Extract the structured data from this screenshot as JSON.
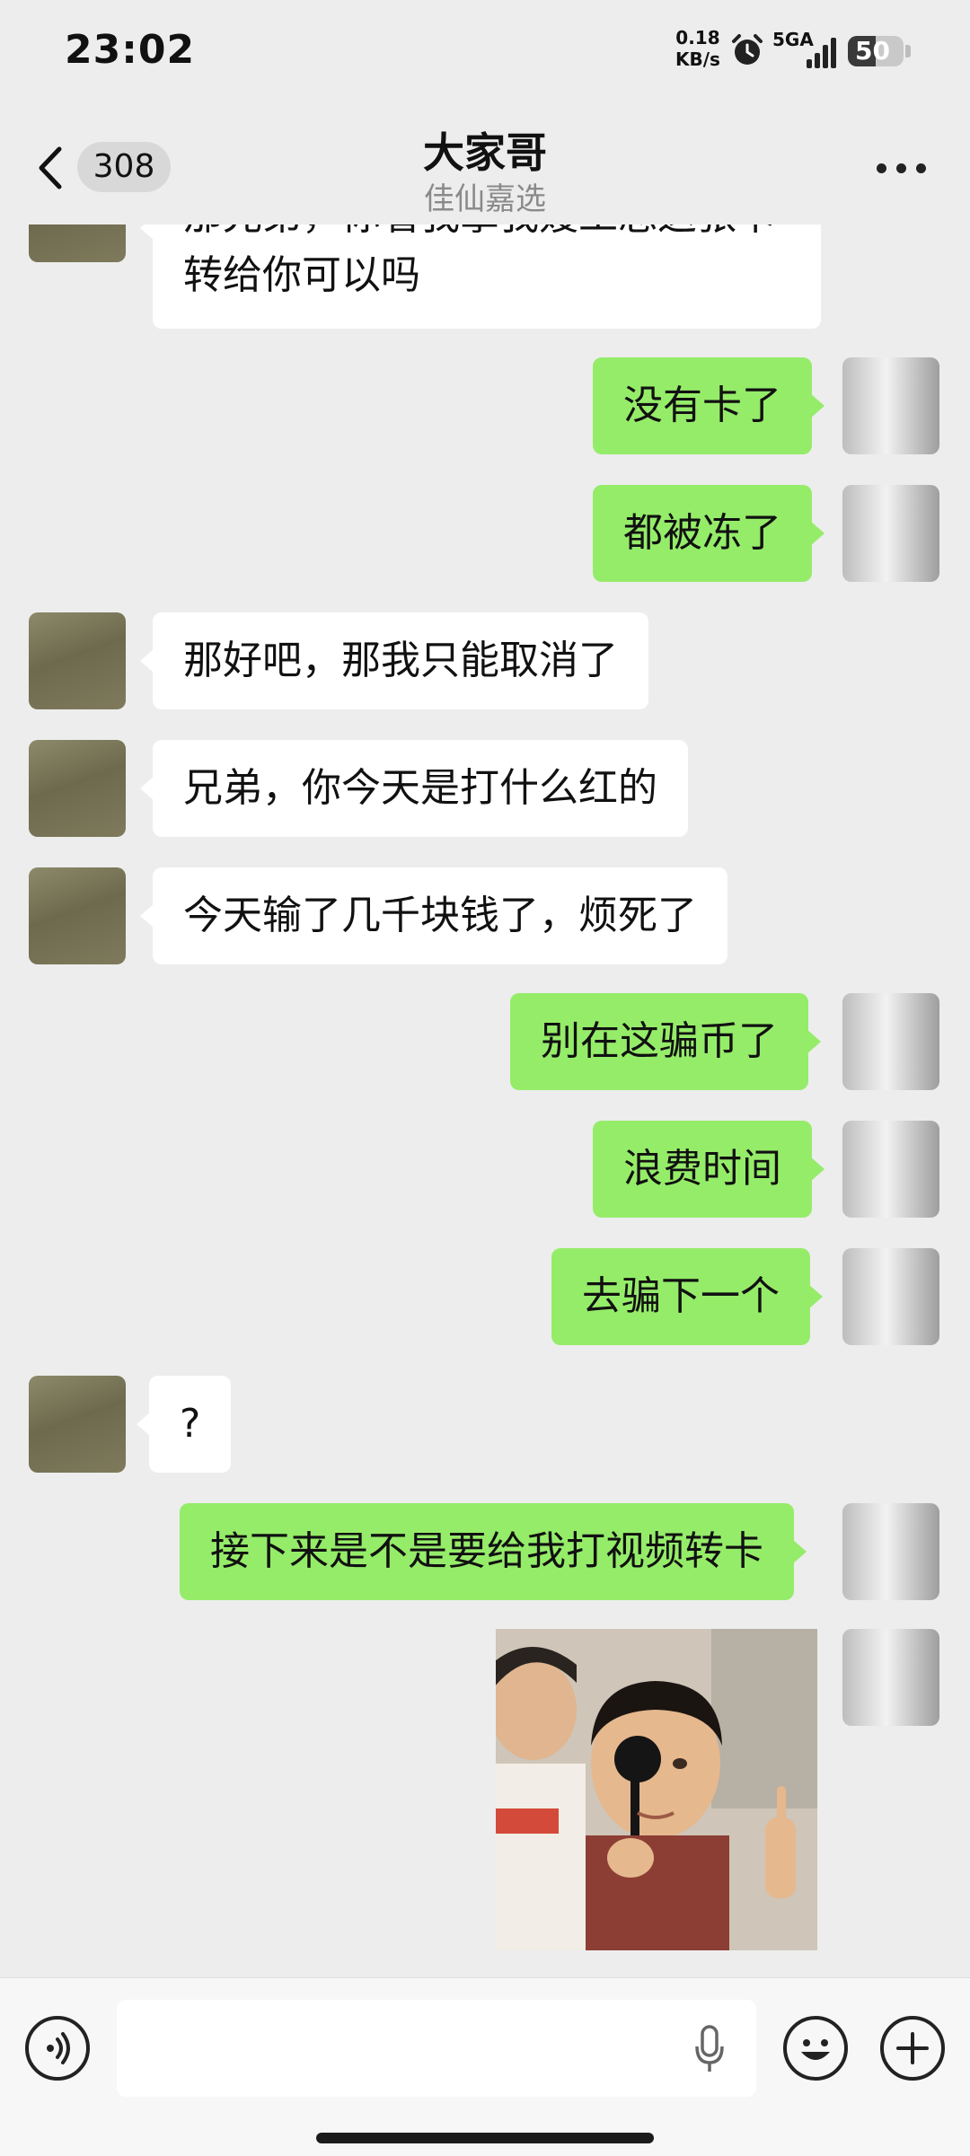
{
  "status_bar": {
    "time": "23:02",
    "net_speed_value": "0.18",
    "net_speed_unit": "KB/s",
    "network": "5GA",
    "battery": "50",
    "battery_level": 0.5
  },
  "header": {
    "back_count": "308",
    "title": "大家哥",
    "subtitle": "佳仙嘉选"
  },
  "messages": [
    {
      "side": "in",
      "text": "那兄弟，你看我拿我嫂工总这张卡\n转给你可以吗"
    },
    {
      "side": "out",
      "text": "没有卡了"
    },
    {
      "side": "out",
      "text": "都被冻了"
    },
    {
      "side": "in",
      "text": "那好吧，那我只能取消了"
    },
    {
      "side": "in",
      "text": "兄弟，你今天是打什么红的"
    },
    {
      "side": "in",
      "text": "今天输了几千块钱了，烦死了"
    },
    {
      "side": "out",
      "text": "别在这骗币了"
    },
    {
      "side": "out",
      "text": "浪费时间"
    },
    {
      "side": "out",
      "text": "去骗下一个"
    },
    {
      "side": "in",
      "text": "?"
    },
    {
      "side": "out",
      "text": "接下来是不是要给我打视频转卡"
    },
    {
      "side": "out",
      "type": "image",
      "icon": "meme-photo"
    }
  ],
  "input_bar": {
    "voice_icon": "voice-icon",
    "mic_icon": "mic-icon",
    "emoji_icon": "emoji-icon",
    "add_icon": "plus-icon"
  },
  "colors": {
    "background": "#ededed",
    "outgoing_bubble": "#95ec69",
    "incoming_bubble": "#ffffff"
  }
}
